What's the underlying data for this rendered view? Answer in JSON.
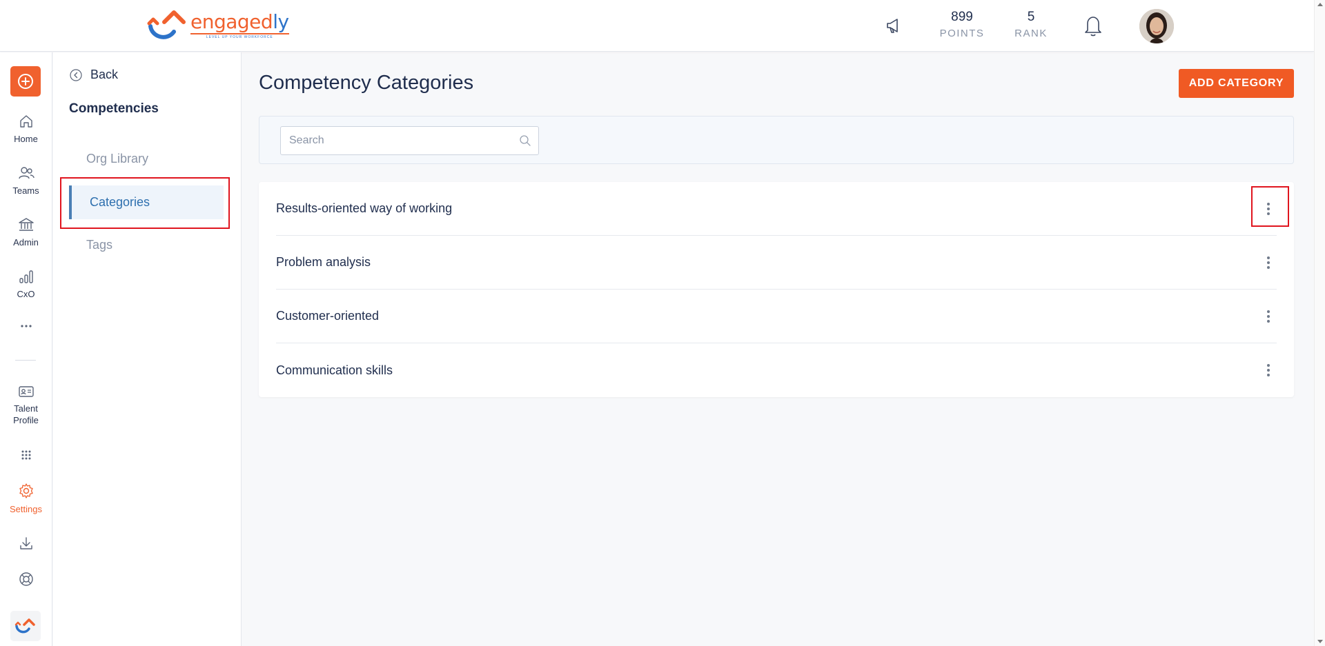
{
  "header": {
    "logo_word_orange": "engaged",
    "logo_word_blue": "ly",
    "logo_tagline": "LEVEL UP YOUR WORKFORCE",
    "points_value": "899",
    "points_label": "POINTS",
    "rank_value": "5",
    "rank_label": "RANK"
  },
  "rail": {
    "items": [
      {
        "label": "Home",
        "icon": "home-icon"
      },
      {
        "label": "Teams",
        "icon": "teams-icon"
      },
      {
        "label": "Admin",
        "icon": "admin-icon"
      },
      {
        "label": "CxO",
        "icon": "chart-icon"
      },
      {
        "label": "Talent Profile",
        "icon": "id-card-icon"
      },
      {
        "label": "Settings",
        "icon": "gear-icon"
      }
    ]
  },
  "subnav": {
    "back_label": "Back",
    "title": "Competencies",
    "items": [
      {
        "label": "Org Library"
      },
      {
        "label": "Categories"
      },
      {
        "label": "Tags"
      }
    ]
  },
  "main": {
    "title": "Competency Categories",
    "add_button": "ADD CATEGORY",
    "search_placeholder": "Search",
    "categories": [
      {
        "name": "Results-oriented way of working"
      },
      {
        "name": "Problem analysis"
      },
      {
        "name": "Customer-oriented"
      },
      {
        "name": "Communication skills"
      }
    ]
  },
  "colors": {
    "brand_orange": "#f05a24",
    "brand_blue": "#2d73c9",
    "active_blue": "#2d6fae",
    "highlight_red": "#e0141e"
  }
}
